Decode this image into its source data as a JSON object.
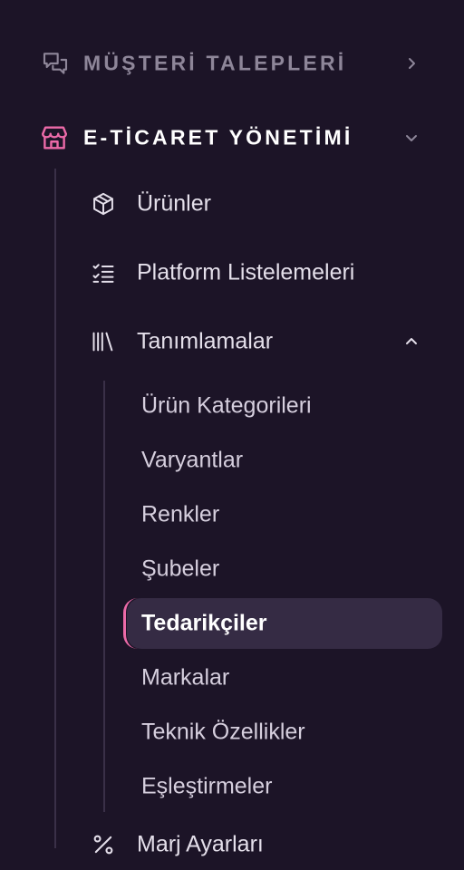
{
  "colors": {
    "background": "#1c1427",
    "accent": "#ec6aa8",
    "active_bg": "#352b44",
    "muted": "#8e8699"
  },
  "sections": {
    "customer_requests": {
      "label": "MÜŞTERİ TALEPLERİ",
      "icon": "chat-bubbles-icon",
      "state": "collapsed"
    },
    "ecommerce": {
      "label": "E-TİCARET YÖNETİMİ",
      "icon": "store-icon",
      "state": "expanded"
    }
  },
  "nav": {
    "products": {
      "label": "Ürünler",
      "icon": "box-icon"
    },
    "platform_listings": {
      "label": "Platform Listelemeleri",
      "icon": "checklist-icon"
    },
    "definitions": {
      "label": "Tanımlamalar",
      "icon": "library-icon",
      "state": "expanded"
    },
    "partial": {
      "label": "Marj Ayarları",
      "icon": "percent-icon"
    }
  },
  "definitions_items": [
    {
      "label": "Ürün Kategorileri"
    },
    {
      "label": "Varyantlar"
    },
    {
      "label": "Renkler"
    },
    {
      "label": "Şubeler"
    },
    {
      "label": "Tedarikçiler",
      "active": true
    },
    {
      "label": "Markalar"
    },
    {
      "label": "Teknik Özellikler"
    },
    {
      "label": "Eşleştirmeler"
    }
  ]
}
